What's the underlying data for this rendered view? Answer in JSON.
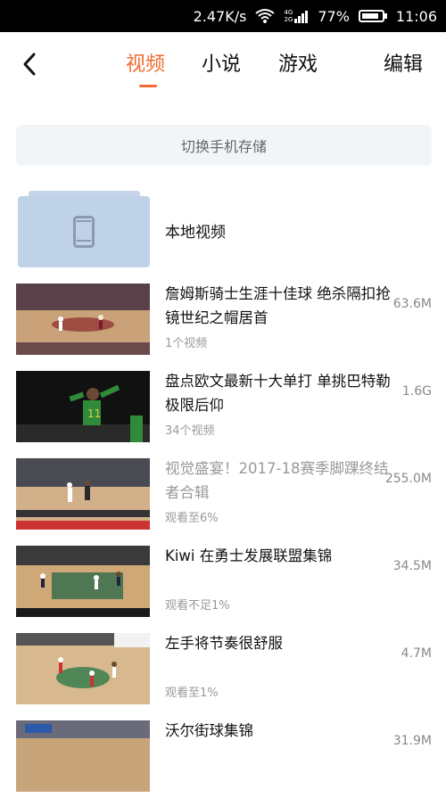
{
  "status_bar": {
    "net_speed": "2.47K/s",
    "net_type_top": "4G",
    "net_type_bottom": "2G",
    "battery": "77%",
    "time": "11:06"
  },
  "header": {
    "tabs": [
      {
        "label": "视频",
        "active": true
      },
      {
        "label": "小说",
        "active": false
      },
      {
        "label": "游戏",
        "active": false
      }
    ],
    "edit_label": "编辑",
    "accent_color": "#f26b2e"
  },
  "storage": {
    "switch_label": "切换手机存储"
  },
  "local_folder": {
    "label": "本地视频",
    "icon": "phone-icon"
  },
  "videos": [
    {
      "title": "詹姆斯骑士生涯十佳球 绝杀隔扣抢镜世纪之帽居首",
      "sub": "1个视频",
      "size": "63.6M",
      "watched": false
    },
    {
      "title": "盘点欧文最新十大单打 单挑巴特勒极限后仰",
      "sub": "34个视频",
      "size": "1.6G",
      "watched": false
    },
    {
      "title": "视觉盛宴！2017-18赛季脚踝终结者合辑",
      "sub": "观看至6%",
      "size": "255.0M",
      "watched": true
    },
    {
      "title": "Kiwi 在勇士发展联盟集锦",
      "sub": "观看不足1%",
      "size": "34.5M",
      "watched": false
    },
    {
      "title": "左手将节奏很舒服",
      "sub": "观看至1%",
      "size": "4.7M",
      "watched": false
    },
    {
      "title": "沃尔街球集锦",
      "sub": "",
      "size": "31.9M",
      "watched": false
    }
  ]
}
